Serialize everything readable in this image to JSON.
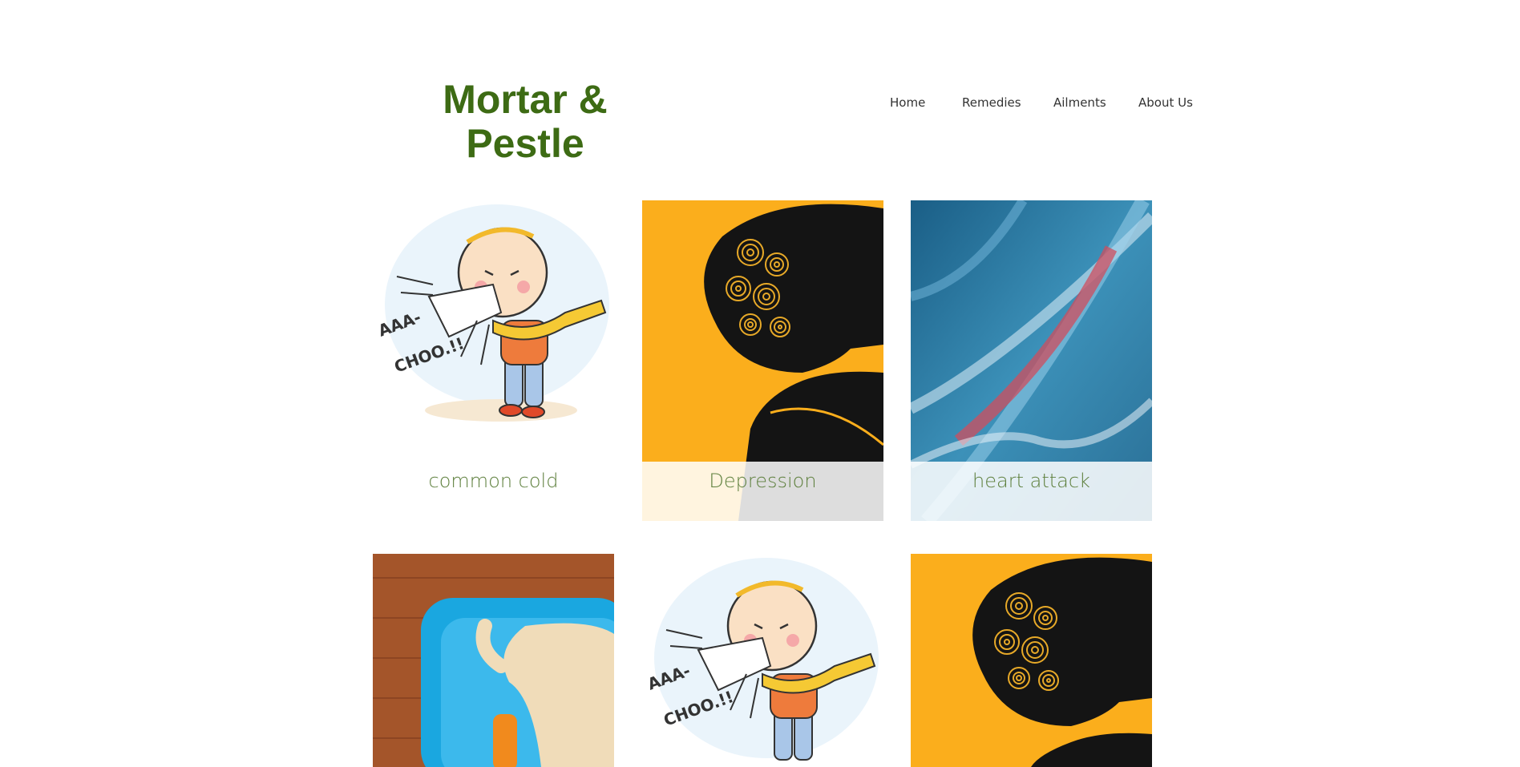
{
  "header": {
    "title": "Mortar & Pestle"
  },
  "nav": {
    "items": [
      {
        "label": "Home"
      },
      {
        "label": "Remedies"
      },
      {
        "label": "Ailments"
      },
      {
        "label": "About Us"
      }
    ]
  },
  "gallery": {
    "items": [
      {
        "caption": "common cold",
        "art": "sneezing-child-illustration"
      },
      {
        "caption": "Depression",
        "art": "head-spirals-illustration"
      },
      {
        "caption": "heart attack",
        "art": "abstract-blue-red-light"
      },
      {
        "caption": "",
        "art": "dog-on-blue-bed-photo"
      },
      {
        "caption": "",
        "art": "sneezing-child-illustration"
      },
      {
        "caption": "",
        "art": "head-spirals-illustration"
      }
    ]
  },
  "colors": {
    "brand_green": "#3d6b14",
    "caption_green": "#5d7f3c",
    "depression_yellow": "#fbae1c",
    "nav_text": "#333333"
  },
  "illustration_text": {
    "sneeze_line1": "AAA-",
    "sneeze_line2": "CHOO.!!"
  }
}
